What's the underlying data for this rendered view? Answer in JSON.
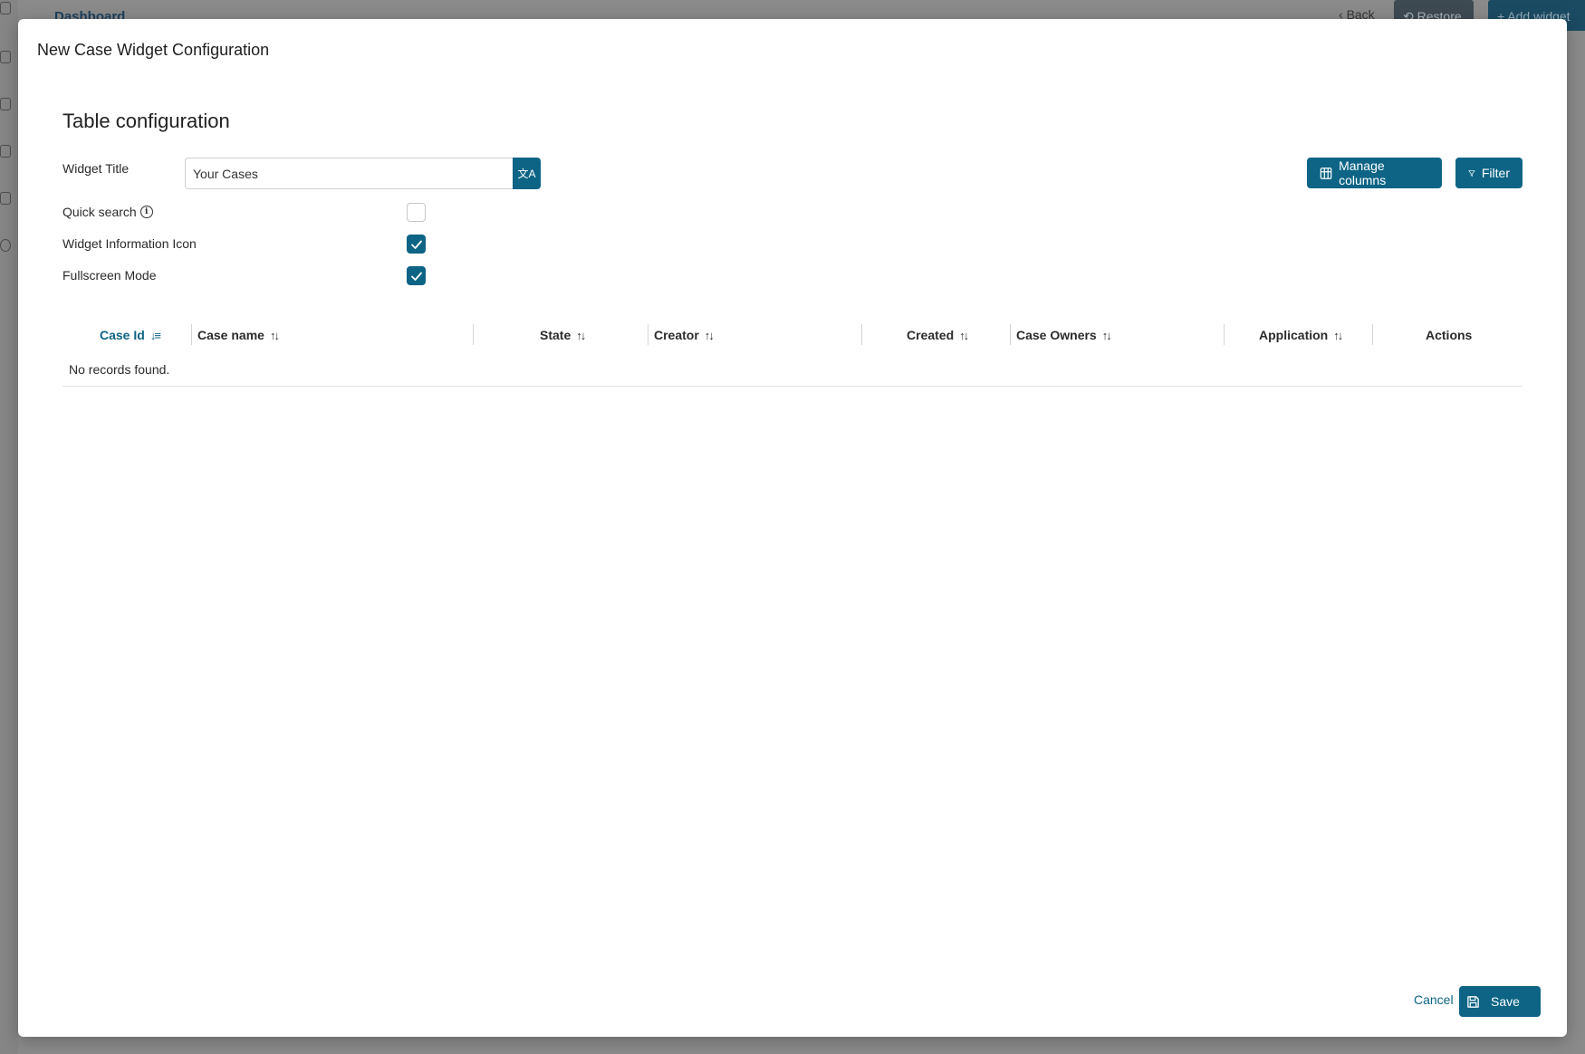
{
  "background": {
    "breadcrumb": "Dashboard",
    "back_label": "Back",
    "restore_label": "Restore",
    "add_widget_label": "Add widget"
  },
  "modal": {
    "title": "New Case Widget Configuration",
    "section_title": "Table configuration",
    "widget_title_label": "Widget Title",
    "widget_title_value": "Your Cases",
    "quick_search_label": "Quick search",
    "quick_search_checked": false,
    "widget_info_icon_label": "Widget Information Icon",
    "widget_info_icon_checked": true,
    "fullscreen_mode_label": "Fullscreen Mode",
    "fullscreen_mode_checked": true,
    "manage_columns_label": "Manage columns",
    "filter_label": "Filter",
    "cancel_label": "Cancel",
    "save_label": "Save"
  },
  "table": {
    "columns": [
      "Case Id",
      "Case name",
      "State",
      "Creator",
      "Created",
      "Case Owners",
      "Application",
      "Actions"
    ],
    "empty_message": "No records found."
  },
  "colors": {
    "primary": "#0d6485",
    "overlay": "#8a8a8a"
  }
}
